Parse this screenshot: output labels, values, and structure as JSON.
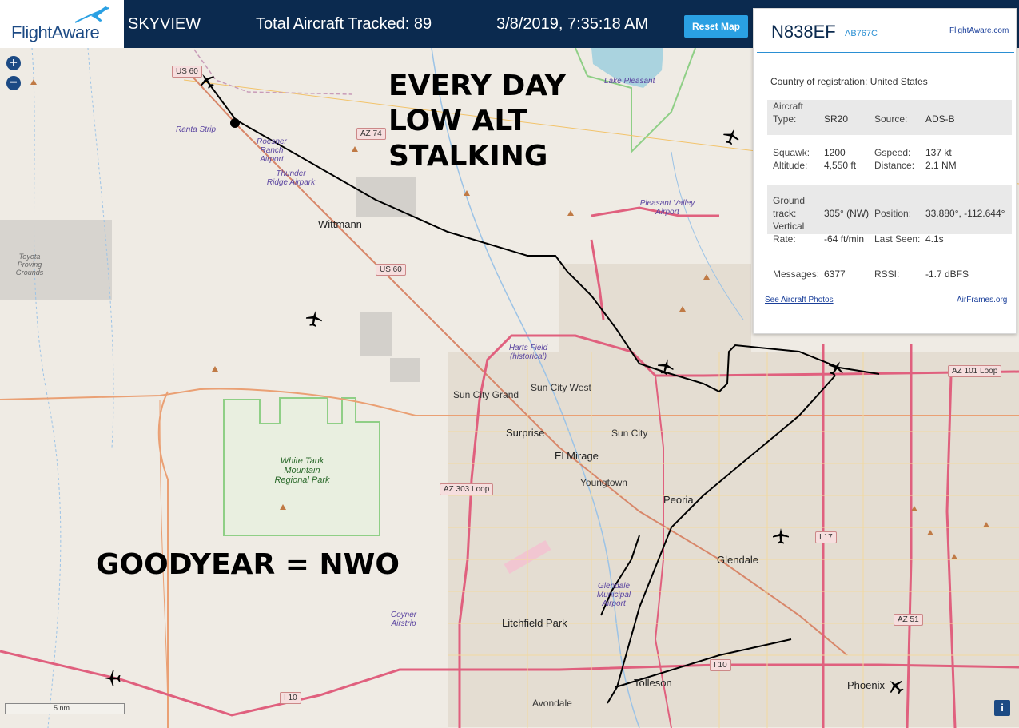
{
  "header": {
    "logo_text": "FlightAware",
    "app_name": "SKYVIEW",
    "tracked": "Total Aircraft Tracked: 89",
    "datetime": "3/8/2019, 7:35:18 AM",
    "reset_label": "Reset Map"
  },
  "map_controls": {
    "zoom_in": "+",
    "zoom_out": "−",
    "scale_label": "5 nm",
    "info_label": "i"
  },
  "overlay_text": {
    "top": "EVERY DAY\nLOW ALT\nSTALKING",
    "bottom": "GOODYEAR = NWO"
  },
  "map_labels": {
    "places": [
      "Wittmann",
      "Sun City Grand",
      "Sun City West",
      "Surprise",
      "Sun City",
      "El Mirage",
      "Youngtown",
      "Peoria",
      "Glendale",
      "Litchfield Park",
      "Tolleson",
      "Avondale",
      "Phoenix"
    ],
    "airports": [
      "Ranta Strip",
      "Roesner Ranch Airport",
      "Thunder Ridge Airpark",
      "Pleasant Valley Airport",
      "Harts Field (historical)",
      "Glendale Municipal Airport",
      "Coyner Airstrip"
    ],
    "parks": [
      "White Tank Mountain Regional Park",
      "Lake Pleasant"
    ],
    "other": [
      "Toyota Proving Grounds"
    ],
    "shields": [
      "US 60",
      "AZ 74",
      "US 60",
      "AZ 303 Loop",
      "AZ 101 Loop",
      "I 17",
      "I 10",
      "I 10",
      "AZ 51"
    ]
  },
  "panel": {
    "registration": "N838EF",
    "hex": "AB767C",
    "link": "FlightAware.com",
    "country_label": "Country of registration:",
    "country_value": "United States",
    "aircraft_type_label": "Aircraft Type:",
    "aircraft_type_value": "SR20",
    "source_label": "Source:",
    "source_value": "ADS-B",
    "squawk_label": "Squawk:",
    "squawk_value": "1200",
    "altitude_label": "Altitude:",
    "altitude_value": "4,550 ft",
    "gspeed_label": "Gspeed:",
    "gspeed_value": "137 kt",
    "distance_label": "Distance:",
    "distance_value": "2.1 NM",
    "ground_track_label": "Ground track:",
    "ground_track_value": "305° (NW)",
    "position_label": "Position:",
    "position_value": "33.880°, -112.644°",
    "vertical_rate_label": "Vertical Rate:",
    "vertical_rate_value": "-64 ft/min",
    "last_seen_label": "Last Seen:",
    "last_seen_value": "4.1s",
    "messages_label": "Messages:",
    "messages_value": "6377",
    "rssi_label": "RSSI:",
    "rssi_value": "-1.7 dBFS",
    "photos_link": "See Aircraft Photos",
    "airframes_link": "AirFrames.org"
  },
  "colors": {
    "header_bg": "#0b2a4f",
    "accent": "#2aa0e3",
    "track": "#000000",
    "highway": "#e0607e"
  }
}
